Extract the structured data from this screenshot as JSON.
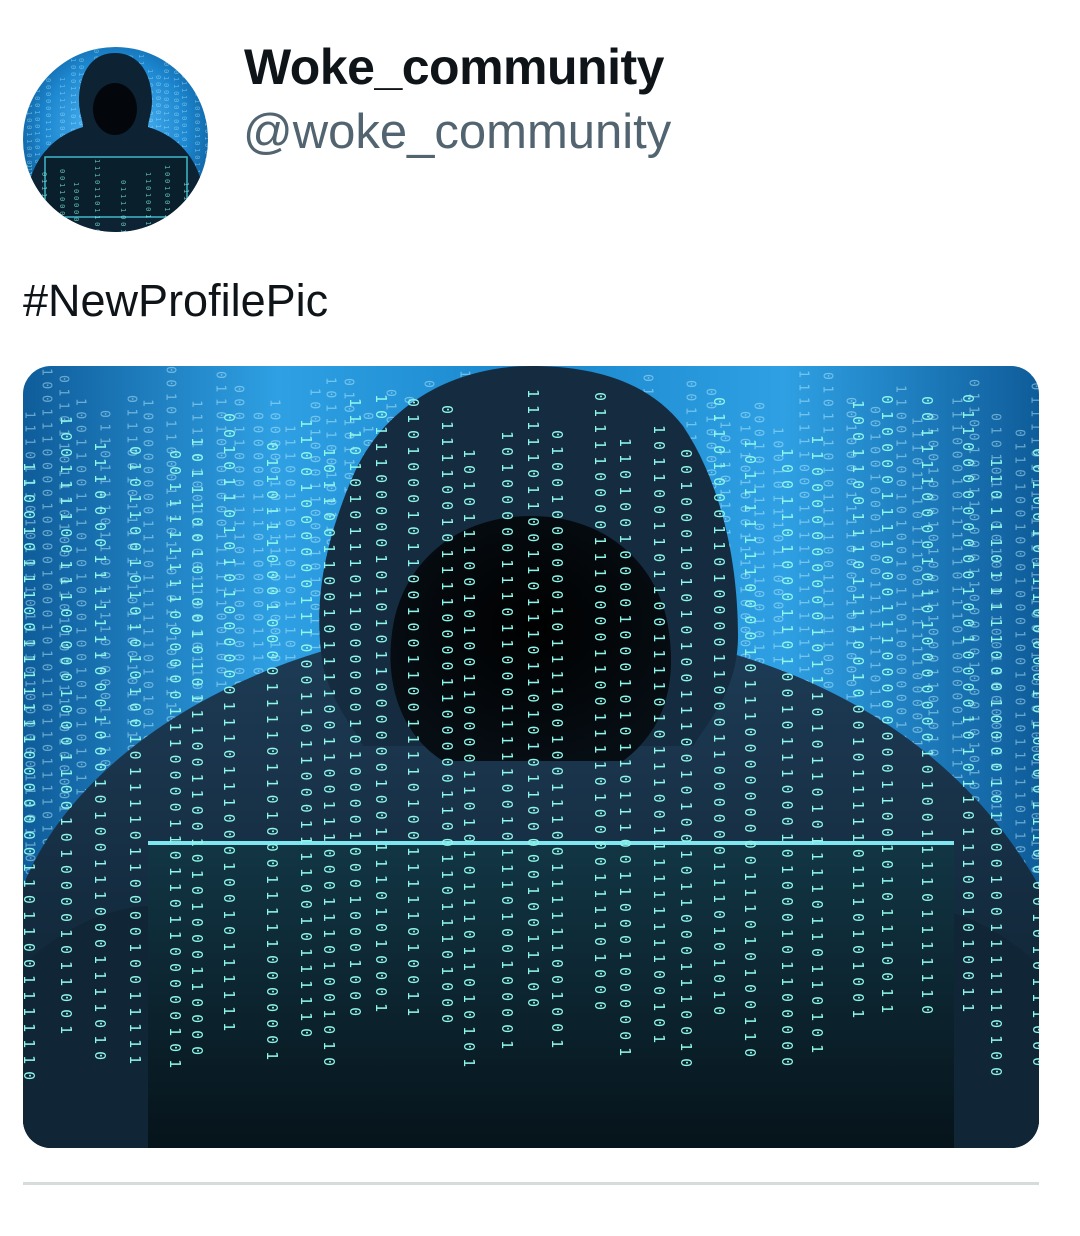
{
  "tweet": {
    "display_name": "Woke_community",
    "handle": "@woke_community",
    "text": "#NewProfilePic",
    "avatar_icon": "hooded-hacker-avatar",
    "media_icon": "hooded-hacker-binary-image"
  },
  "colors": {
    "text_primary": "#0f1419",
    "text_secondary": "#536471",
    "image_blue": "#1e8fd0",
    "code_cyan": "#7ff5e6",
    "divider": "#d6dcdc"
  }
}
